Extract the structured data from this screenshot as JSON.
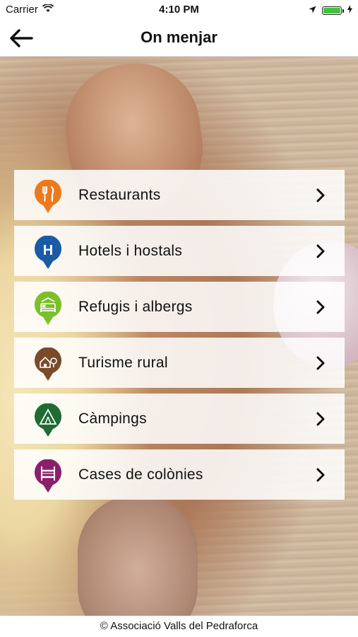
{
  "status_bar": {
    "carrier": "Carrier",
    "time": "4:10 PM"
  },
  "nav": {
    "title": "On menjar"
  },
  "menu": {
    "items": [
      {
        "label": "Restaurants",
        "icon": "cutlery-icon",
        "color": "#ec7a1c"
      },
      {
        "label": "Hotels i hostals",
        "icon": "hotel-h-icon",
        "color": "#1b5aa4"
      },
      {
        "label": "Refugis i albergs",
        "icon": "bed-icon",
        "color": "#7bbf2a"
      },
      {
        "label": "Turisme rural",
        "icon": "rural-house-icon",
        "color": "#7a4a2a"
      },
      {
        "label": "Càmpings",
        "icon": "tent-icon",
        "color": "#1e6b34"
      },
      {
        "label": "Cases de colònies",
        "icon": "bunk-bed-icon",
        "color": "#8a1f6a"
      }
    ]
  },
  "footer": {
    "text": "© Associació Valls del Pedraforca"
  }
}
